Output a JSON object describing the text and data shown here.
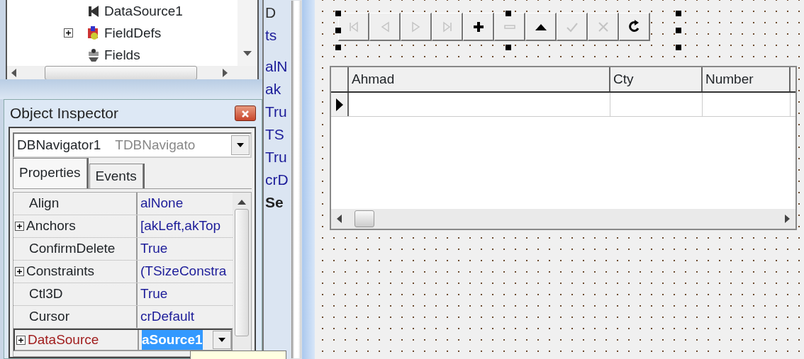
{
  "tree": {
    "items": [
      {
        "label": "DataSource1",
        "expandable": false
      },
      {
        "label": "FieldDefs",
        "expandable": true
      },
      {
        "label": "Fields",
        "expandable": false
      }
    ]
  },
  "background_fragments": [
    "D",
    "ts",
    "alN",
    "ak",
    "Tru",
    "TS",
    "Tru",
    "crD",
    "Se"
  ],
  "object_inspector": {
    "title": "Object Inspector",
    "component": {
      "name": "DBNavigator1",
      "class": "TDBNavigato"
    },
    "tabs": [
      {
        "label": "Properties",
        "selected": true
      },
      {
        "label": "Events",
        "selected": false
      }
    ],
    "properties": [
      {
        "name": "Align",
        "value": "alNone",
        "expandable": false,
        "kind": "plain",
        "selected": false
      },
      {
        "name": "Anchors",
        "value": "[akLeft,akTop",
        "expandable": true,
        "kind": "plain",
        "selected": false
      },
      {
        "name": "ConfirmDelete",
        "value": "True",
        "expandable": false,
        "kind": "plain",
        "selected": false
      },
      {
        "name": "Constraints",
        "value": "(TSizeConstra",
        "expandable": true,
        "kind": "plain",
        "selected": false
      },
      {
        "name": "Ctl3D",
        "value": "True",
        "expandable": false,
        "kind": "plain",
        "selected": false
      },
      {
        "name": "Cursor",
        "value": "crDefault",
        "expandable": false,
        "kind": "plain",
        "selected": false
      },
      {
        "name": "DataSource",
        "value": "aSource1",
        "expandable": true,
        "kind": "reference",
        "selected": true
      }
    ]
  },
  "designer": {
    "navigator": {
      "buttons": [
        {
          "kind": "first",
          "enabled": false
        },
        {
          "kind": "prior",
          "enabled": false
        },
        {
          "kind": "next",
          "enabled": false
        },
        {
          "kind": "last",
          "enabled": false
        },
        {
          "kind": "insert",
          "enabled": true
        },
        {
          "kind": "delete",
          "enabled": false
        },
        {
          "kind": "edit",
          "enabled": true
        },
        {
          "kind": "post",
          "enabled": false
        },
        {
          "kind": "cancel",
          "enabled": false
        },
        {
          "kind": "refresh",
          "enabled": true
        }
      ]
    },
    "grid": {
      "columns": [
        "Ahmad",
        "Cty",
        "Number"
      ]
    }
  }
}
